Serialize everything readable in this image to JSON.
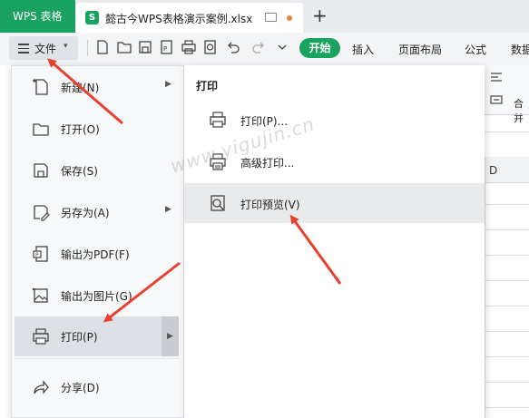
{
  "app": {
    "name": "WPS 表格",
    "document_title": "懿古今WPS表格演示案例.xlsx",
    "new_tab_symbol": "+"
  },
  "toolbar": {
    "file_label": "文件",
    "ribbon_tabs": [
      "开始",
      "插入",
      "页面布局",
      "公式",
      "数据"
    ]
  },
  "file_menu": {
    "items": [
      {
        "label": "新建(N)",
        "icon": "new-file-icon",
        "has_submenu": true
      },
      {
        "label": "打开(O)",
        "icon": "folder-icon",
        "has_submenu": false
      },
      {
        "label": "保存(S)",
        "icon": "save-icon",
        "has_submenu": false
      },
      {
        "label": "另存为(A)",
        "icon": "save-as-icon",
        "has_submenu": true
      },
      {
        "label": "输出为PDF(F)",
        "icon": "pdf-icon",
        "has_submenu": false
      },
      {
        "label": "输出为图片(G)",
        "icon": "image-icon",
        "has_submenu": false
      },
      {
        "label": "打印(P)",
        "icon": "printer-icon",
        "has_submenu": true,
        "selected": true
      },
      {
        "label": "分享(D)",
        "icon": "share-icon",
        "has_submenu": false
      }
    ]
  },
  "print_submenu": {
    "title": "打印",
    "items": [
      {
        "label": "打印(P)...",
        "icon": "printer-icon"
      },
      {
        "label": "高级打印...",
        "icon": "advanced-print-icon"
      },
      {
        "label": "打印预览(V)",
        "icon": "print-preview-icon",
        "selected": true
      }
    ]
  },
  "sheet": {
    "visible_column": "D",
    "toolbar_partial_label": "合并"
  },
  "watermark": "www.yigujin.cn",
  "colors": {
    "accent": "#1aa260",
    "annotation_arrow": "#e8402f"
  }
}
